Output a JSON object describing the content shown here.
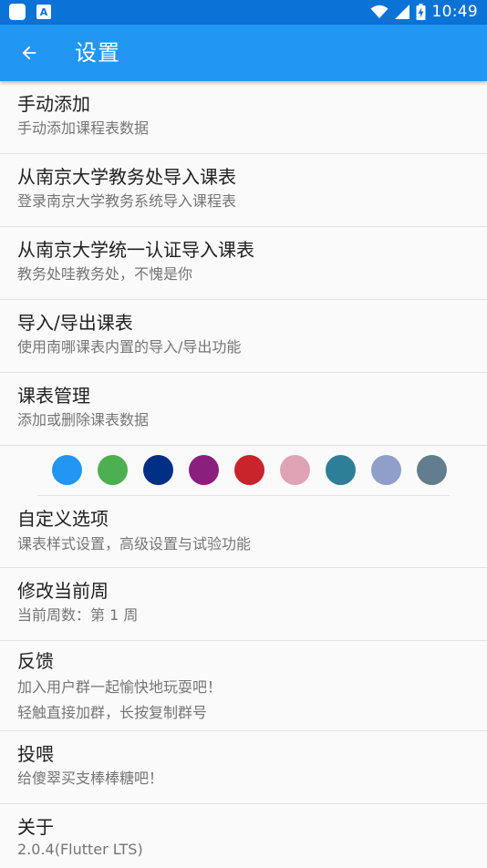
{
  "status_bar": {
    "time": "10:49",
    "notif_icon_letter": "A",
    "icons": [
      "square-notification-icon",
      "android-a-icon",
      "wifi-icon",
      "signal-icon",
      "battery-charging-icon"
    ]
  },
  "app_bar": {
    "title": "设置",
    "back_icon": "arrow-left-icon",
    "background": "#2196f3",
    "status_color": "#0b73d6"
  },
  "items": [
    {
      "title": "手动添加",
      "subtitle": "手动添加课程表数据"
    },
    {
      "title": "从南京大学教务处导入课表",
      "subtitle": "登录南京大学教务系统导入课程表"
    },
    {
      "title": "从南京大学统一认证导入课表",
      "subtitle": "教务处哇教务处，不愧是你"
    },
    {
      "title": "导入/导出课表",
      "subtitle": "使用南哪课表内置的导入/导出功能"
    },
    {
      "title": "课表管理",
      "subtitle": "添加或删除课表数据"
    }
  ],
  "theme_colors": [
    "#2196f3",
    "#4caf50",
    "#012f86",
    "#8a1f7e",
    "#c9232b",
    "#e0a2b5",
    "#2c7f97",
    "#8f9fca",
    "#617d8e"
  ],
  "items2": [
    {
      "title": "自定义选项",
      "subtitle": "课表样式设置，高级设置与试验功能"
    },
    {
      "title": "修改当前周",
      "subtitle": "当前周数：第 1 周"
    },
    {
      "title": "反馈",
      "subtitle": "加入用户群一起愉快地玩耍吧！",
      "subtitle2": "轻触直接加群，长按复制群号"
    },
    {
      "title": "投喂",
      "subtitle": "给傻翠买支棒棒糖吧！"
    },
    {
      "title": "关于",
      "subtitle": "2.0.4(Flutter LTS)"
    }
  ]
}
